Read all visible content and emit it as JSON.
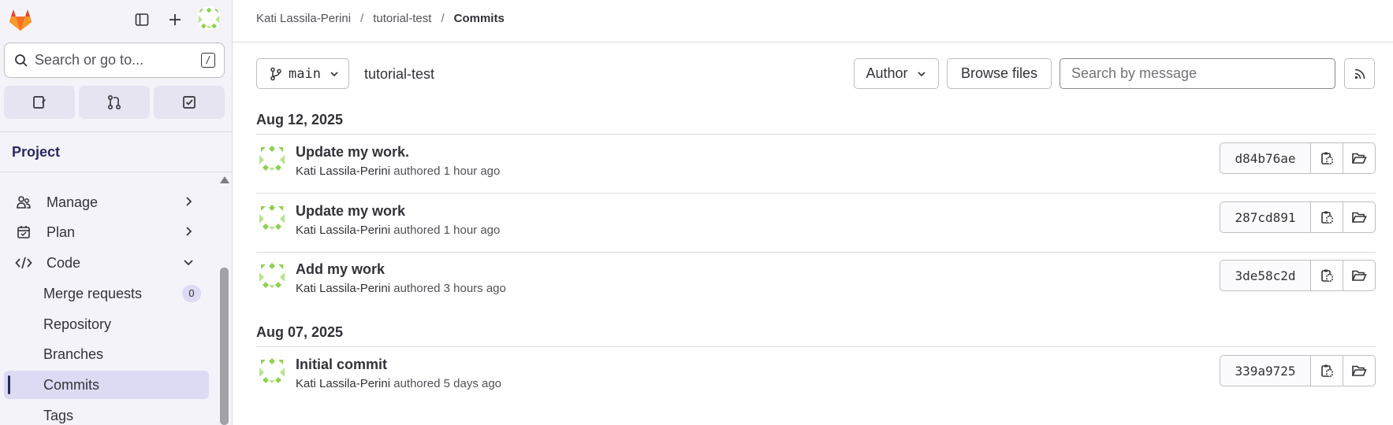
{
  "sidebar": {
    "search_placeholder": "Search or go to...",
    "search_shortcut": "/",
    "section_title": "Project",
    "items": [
      {
        "label": "Manage"
      },
      {
        "label": "Plan"
      },
      {
        "label": "Code"
      },
      {
        "label": "Merge requests",
        "badge": "0"
      },
      {
        "label": "Repository"
      },
      {
        "label": "Branches"
      },
      {
        "label": "Commits"
      },
      {
        "label": "Tags"
      }
    ]
  },
  "breadcrumb": {
    "user": "Kati Lassila-Perini",
    "project": "tutorial-test",
    "current": "Commits",
    "sep": "/"
  },
  "toolbar": {
    "branch": "main",
    "path": "tutorial-test",
    "author_label": "Author",
    "browse_label": "Browse files",
    "search_placeholder": "Search by message"
  },
  "groups": [
    {
      "date": "Aug 12, 2025",
      "commits": [
        {
          "title": "Update my work.",
          "author": "Kati Lassila-Perini",
          "verb": "authored",
          "time": "1 hour ago",
          "sha": "d84b76ae"
        },
        {
          "title": "Update my work",
          "author": "Kati Lassila-Perini",
          "verb": "authored",
          "time": "1 hour ago",
          "sha": "287cd891"
        },
        {
          "title": "Add my work",
          "author": "Kati Lassila-Perini",
          "verb": "authored",
          "time": "3 hours ago",
          "sha": "3de58c2d"
        }
      ]
    },
    {
      "date": "Aug 07, 2025",
      "commits": [
        {
          "title": "Initial commit",
          "author": "Kati Lassila-Perini",
          "verb": "authored",
          "time": "5 days ago",
          "sha": "339a9725"
        }
      ]
    }
  ],
  "colors": {
    "sidebar_bg": "#f4f3f9",
    "active_item_bg": "#dcdbf3",
    "project_title": "#292961",
    "avatar_green": "#8fd14f"
  },
  "icons": [
    "gitlab-logo",
    "sidebar-toggle-icon",
    "plus-icon",
    "search-icon",
    "issues-icon",
    "merge-request-icon",
    "todo-icon",
    "users-icon",
    "calendar-icon",
    "code-icon",
    "chevron-right-icon",
    "chevron-down-icon",
    "branch-icon",
    "rss-icon",
    "copy-icon",
    "folder-icon"
  ]
}
